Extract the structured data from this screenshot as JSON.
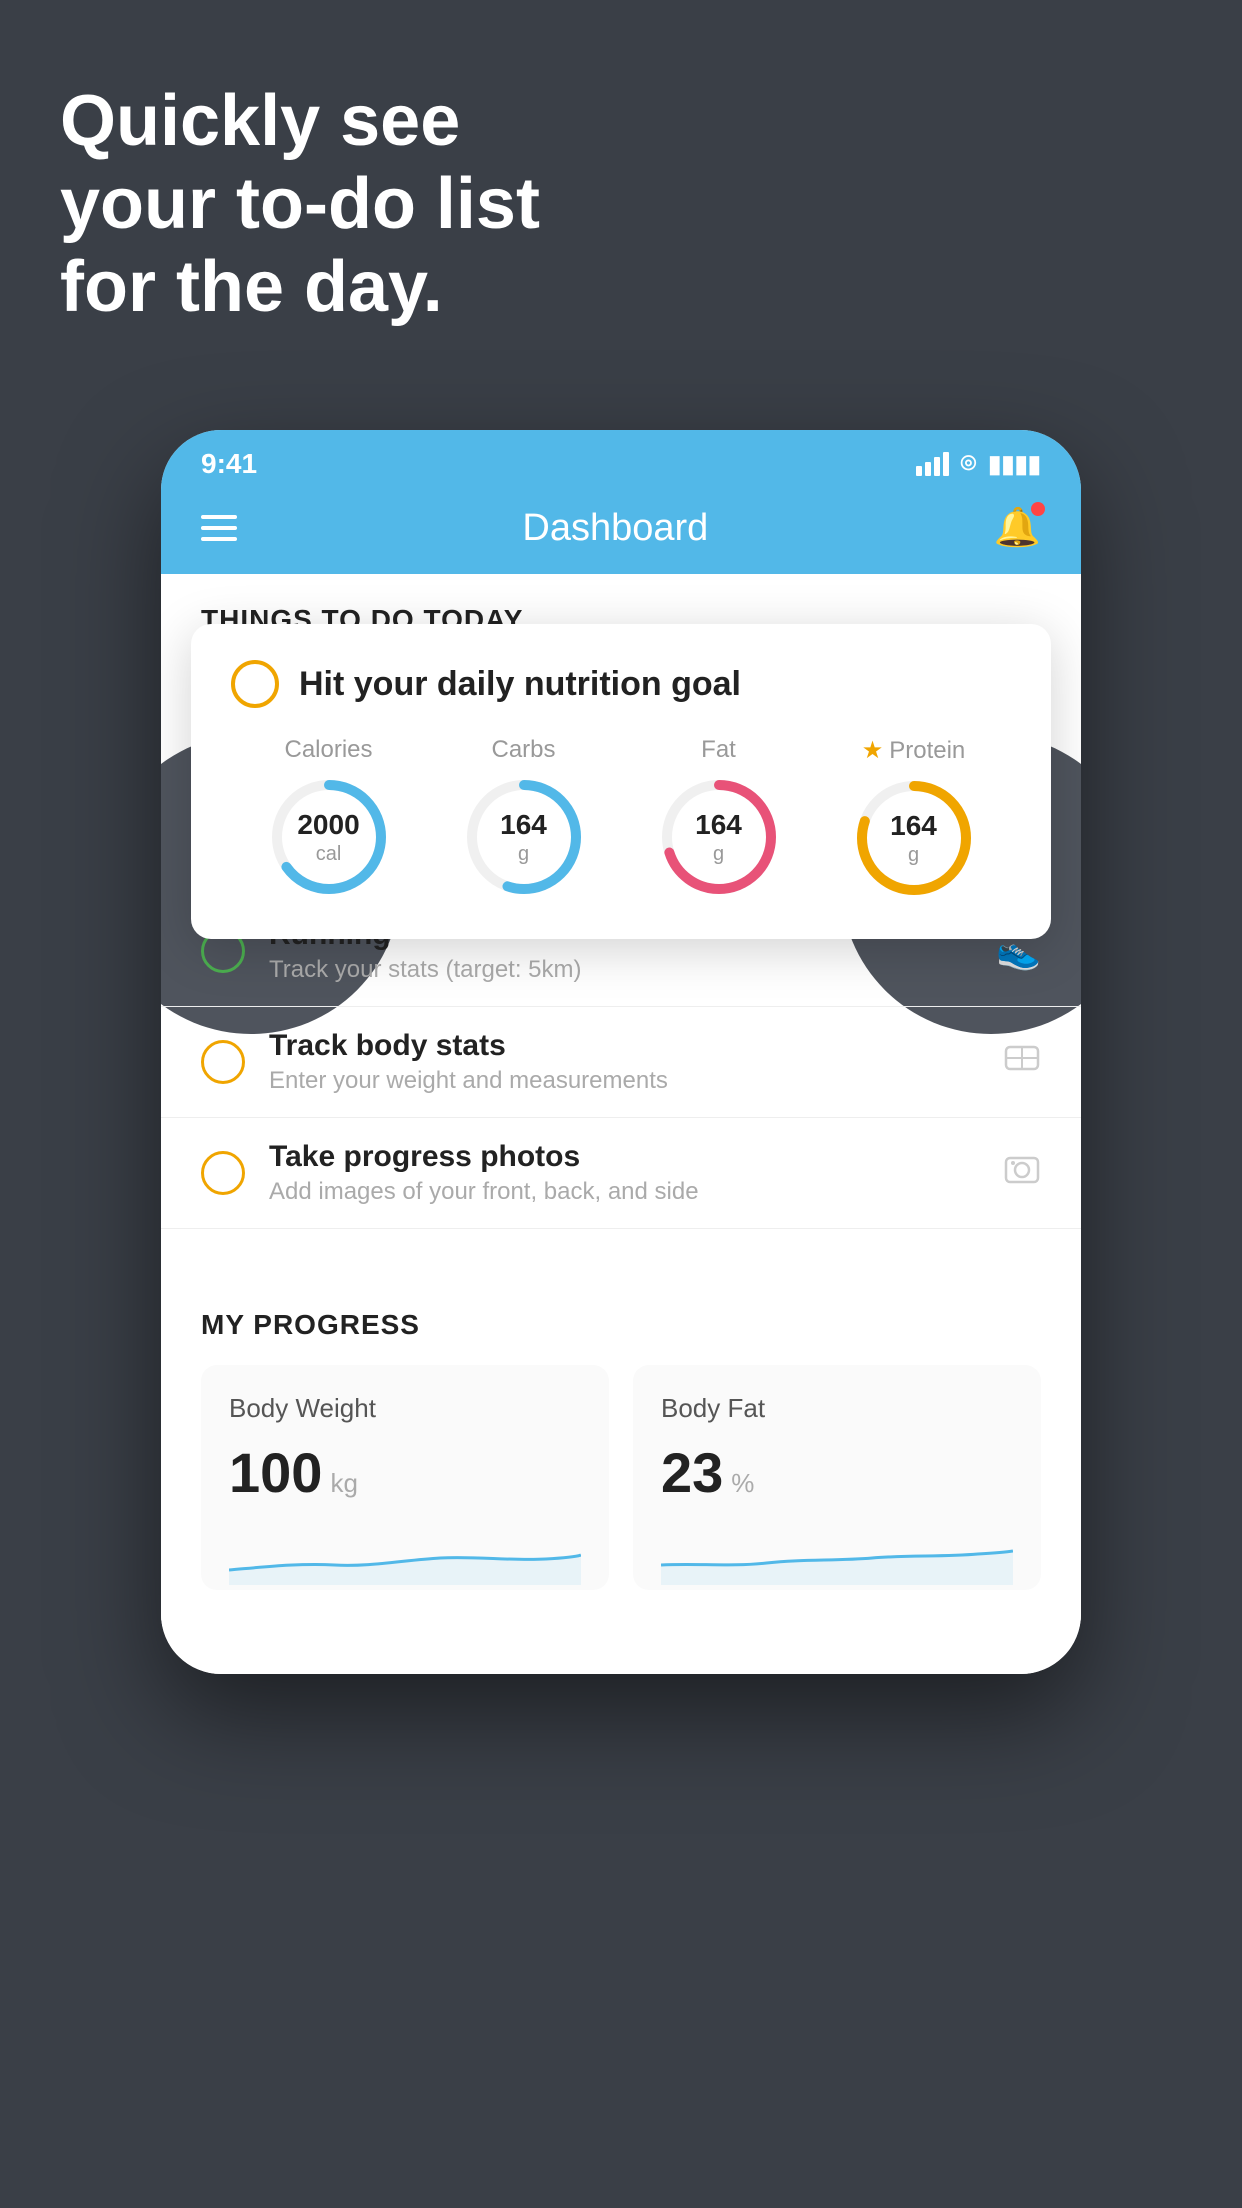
{
  "hero": {
    "line1": "Quickly see",
    "line2": "your to-do list",
    "line3": "for the day."
  },
  "statusBar": {
    "time": "9:41"
  },
  "navBar": {
    "title": "Dashboard"
  },
  "thingsToDo": {
    "header": "THINGS TO DO TODAY"
  },
  "floatingCard": {
    "title": "Hit your daily nutrition goal",
    "calories": {
      "label": "Calories",
      "value": "2000",
      "unit": "cal",
      "percent": 65
    },
    "carbs": {
      "label": "Carbs",
      "value": "164",
      "unit": "g",
      "percent": 55
    },
    "fat": {
      "label": "Fat",
      "value": "164",
      "unit": "g",
      "percent": 70
    },
    "protein": {
      "label": "Protein",
      "value": "164",
      "unit": "g",
      "percent": 80
    }
  },
  "todoItems": [
    {
      "title": "Running",
      "subtitle": "Track your stats (target: 5km)",
      "circleColor": "green",
      "icon": "shoe"
    },
    {
      "title": "Track body stats",
      "subtitle": "Enter your weight and measurements",
      "circleColor": "yellow",
      "icon": "scale"
    },
    {
      "title": "Take progress photos",
      "subtitle": "Add images of your front, back, and side",
      "circleColor": "yellow",
      "icon": "photo"
    }
  ],
  "progress": {
    "header": "MY PROGRESS",
    "bodyWeight": {
      "title": "Body Weight",
      "value": "100",
      "unit": "kg"
    },
    "bodyFat": {
      "title": "Body Fat",
      "value": "23",
      "unit": "%"
    }
  }
}
